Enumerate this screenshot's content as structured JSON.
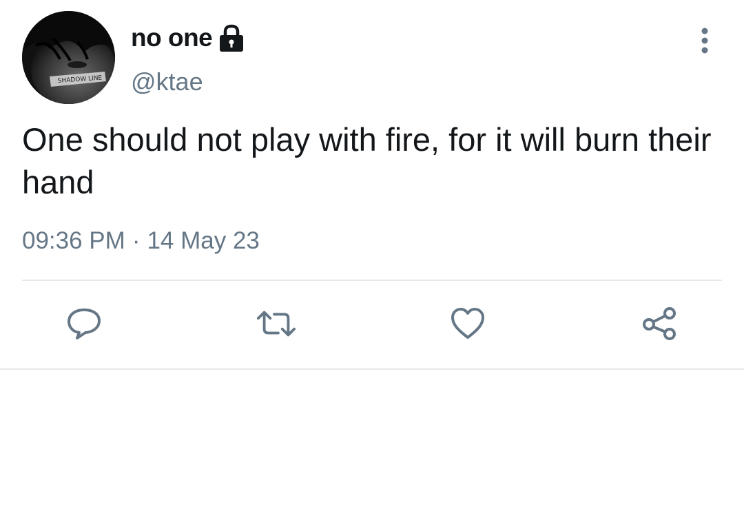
{
  "tweet": {
    "author": {
      "display_name": "no one",
      "handle": "@ktae",
      "protected_icon": "lock-icon",
      "avatar_text": "SHADOW LINE"
    },
    "text": "One should not play with fire, for it will burn their hand",
    "time": "09:36 PM",
    "separator": "·",
    "date": "14 May 23",
    "menu_icon": "more-vertical-icon",
    "actions": {
      "reply_icon": "reply-icon",
      "retweet_icon": "retweet-icon",
      "like_icon": "heart-icon",
      "share_icon": "share-icon"
    }
  },
  "colors": {
    "text_primary": "#14171a",
    "text_secondary": "#657786",
    "divider": "#e6e8ea",
    "icon": "#657786"
  }
}
